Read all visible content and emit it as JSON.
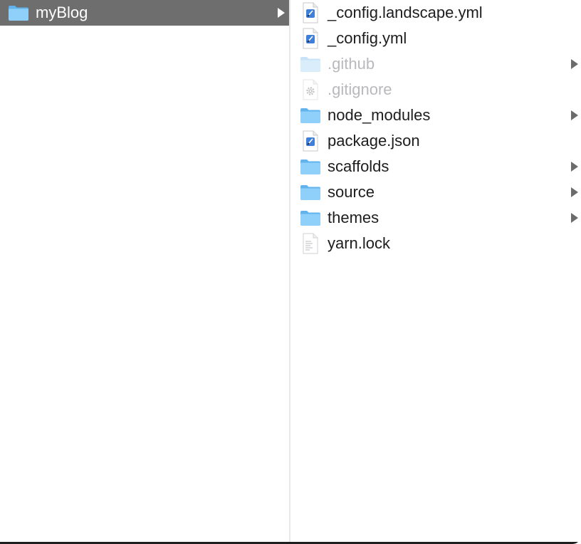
{
  "columns": {
    "left": {
      "items": [
        {
          "name": "myBlog",
          "kind": "folder",
          "icon": "folder-icon",
          "selected": true,
          "has_children": true
        }
      ]
    },
    "right": {
      "items": [
        {
          "name": "_config.landscape.yml",
          "kind": "file",
          "icon": "yml-document-icon",
          "dimmed": false,
          "has_children": false
        },
        {
          "name": "_config.yml",
          "kind": "file",
          "icon": "yml-document-icon",
          "dimmed": false,
          "has_children": false
        },
        {
          "name": ".github",
          "kind": "folder",
          "icon": "folder-icon",
          "dimmed": true,
          "has_children": true
        },
        {
          "name": ".gitignore",
          "kind": "file",
          "icon": "gear-document-icon",
          "dimmed": true,
          "has_children": false
        },
        {
          "name": "node_modules",
          "kind": "folder",
          "icon": "folder-icon",
          "dimmed": false,
          "has_children": true
        },
        {
          "name": "package.json",
          "kind": "file",
          "icon": "json-document-icon",
          "dimmed": false,
          "has_children": false
        },
        {
          "name": "scaffolds",
          "kind": "folder",
          "icon": "folder-icon",
          "dimmed": false,
          "has_children": true
        },
        {
          "name": "source",
          "kind": "folder",
          "icon": "folder-icon",
          "dimmed": false,
          "has_children": true
        },
        {
          "name": "themes",
          "kind": "folder",
          "icon": "folder-icon",
          "dimmed": false,
          "has_children": true
        },
        {
          "name": "yarn.lock",
          "kind": "file",
          "icon": "text-document-icon",
          "dimmed": false,
          "has_children": false
        }
      ]
    }
  },
  "colors": {
    "selection": "#6e6e6e",
    "text": "#1d1d1f",
    "dimmed_text": "#b9b9bd",
    "folder_body": "#83c6f5",
    "folder_tab": "#62b2ec",
    "chevron": "#6b6b6b"
  }
}
